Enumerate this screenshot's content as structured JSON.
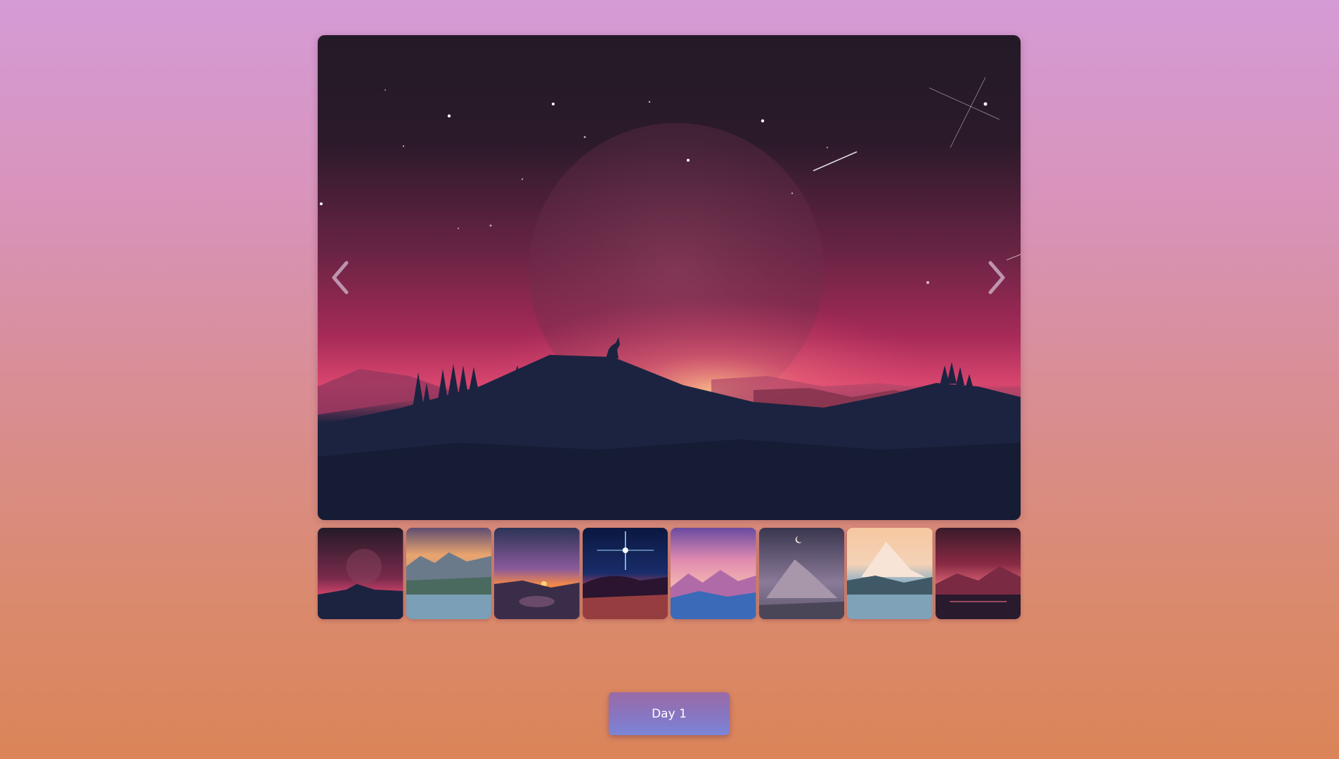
{
  "gallery": {
    "main_image_icon": "wolf-howling-moon-landscape",
    "prev_icon": "chevron-left-icon",
    "next_icon": "chevron-right-icon",
    "thumbnails": [
      {
        "icon": "wolf-moon-thumbnail",
        "selected": true
      },
      {
        "icon": "forest-lake-birds-thumbnail"
      },
      {
        "icon": "sunset-deer-lake-thumbnail"
      },
      {
        "icon": "starburst-night-thumbnail"
      },
      {
        "icon": "purple-mountains-thumbnail"
      },
      {
        "icon": "moon-mountain-fog-thumbnail"
      },
      {
        "icon": "snowy-mountain-lake-thumbnail"
      },
      {
        "icon": "red-dusk-lake-thumbnail"
      }
    ]
  },
  "day_button": {
    "label": "Day 1"
  },
  "colors": {
    "background_top": "#d59bd6",
    "background_bottom": "#db8459",
    "button_top": "#9b6aa6",
    "button_bottom": "#7b85d8"
  }
}
